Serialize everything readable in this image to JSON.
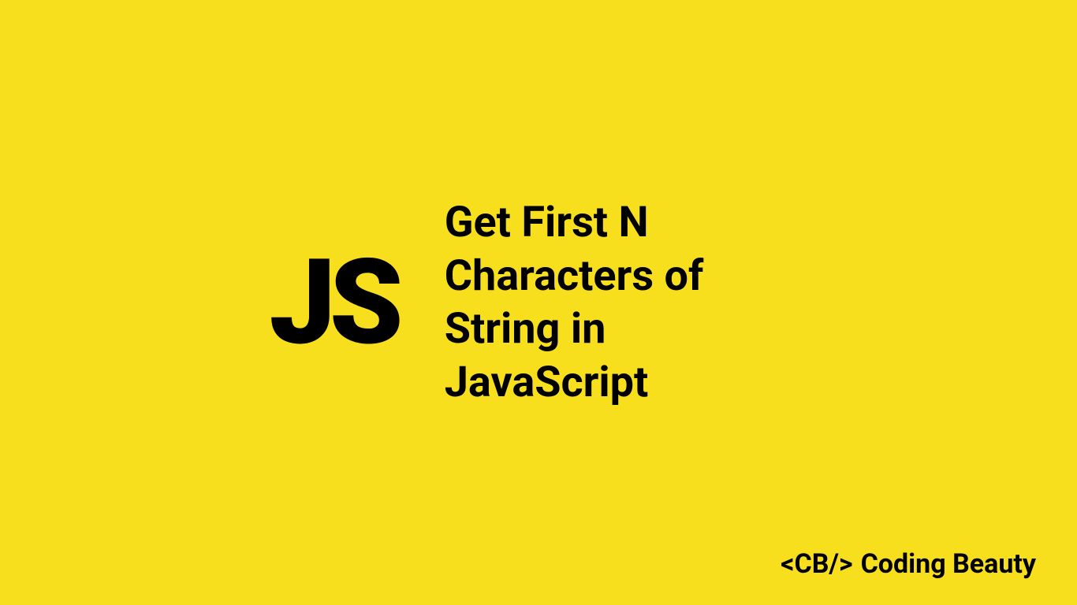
{
  "logo": {
    "text": "JS"
  },
  "title": "Get First N Characters of String in JavaScript",
  "footer": {
    "tag": "<CB/>",
    "name": "Coding Beauty"
  },
  "colors": {
    "background": "#f7df1e",
    "text": "#000000"
  }
}
